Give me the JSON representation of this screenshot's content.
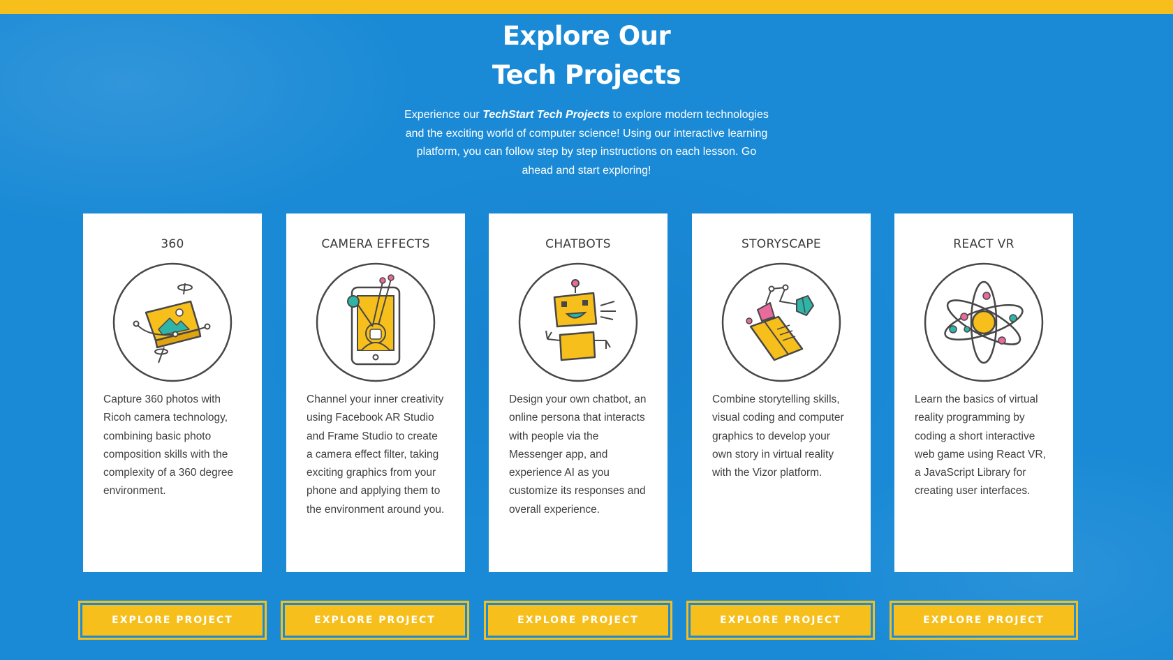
{
  "colors": {
    "accent": "#f7bf1c",
    "background": "#1a8ad6",
    "card": "#ffffff",
    "ink": "#3a3a3a"
  },
  "hero": {
    "title_line1": "Explore Our",
    "title_line2": "Tech Projects",
    "intro_before": "Experience our ",
    "intro_brand": "TechStart Tech Projects",
    "intro_after": " to explore modern technologies and the exciting world of computer science! Using our interactive learning platform, you can follow step by step instructions on each lesson. Go ahead and start exploring!"
  },
  "projects": [
    {
      "title": "360",
      "icon": "camera-360-icon",
      "description": "Capture 360 photos with Ricoh camera technology, combining basic photo composition skills with the complexity of a 360 degree environment.",
      "button": "EXPLORE PROJECT"
    },
    {
      "title": "CAMERA EFFECTS",
      "icon": "phone-camera-effects-icon",
      "description": "Channel your inner creativity using Facebook AR Studio and Frame Studio to create a camera effect filter, taking exciting graphics from your phone and applying them to the environment around you.",
      "button": "EXPLORE PROJECT"
    },
    {
      "title": "CHATBOTS",
      "icon": "robot-icon",
      "description": "Design your own chatbot, an online persona that interacts with people via the Messenger app, and experience AI as you customize its responses and overall experience.",
      "button": "EXPLORE PROJECT"
    },
    {
      "title": "STORYSCAPE",
      "icon": "storybook-icon",
      "description": "Combine storytelling skills, visual coding and computer graphics to develop your own story in virtual reality with the Vizor platform.",
      "button": "EXPLORE PROJECT"
    },
    {
      "title": "REACT VR",
      "icon": "atom-icon",
      "description": "Learn the basics of virtual reality programming by coding a short interactive web game using React VR, a JavaScript Library for creating user interfaces.",
      "button": "EXPLORE PROJECT"
    }
  ]
}
